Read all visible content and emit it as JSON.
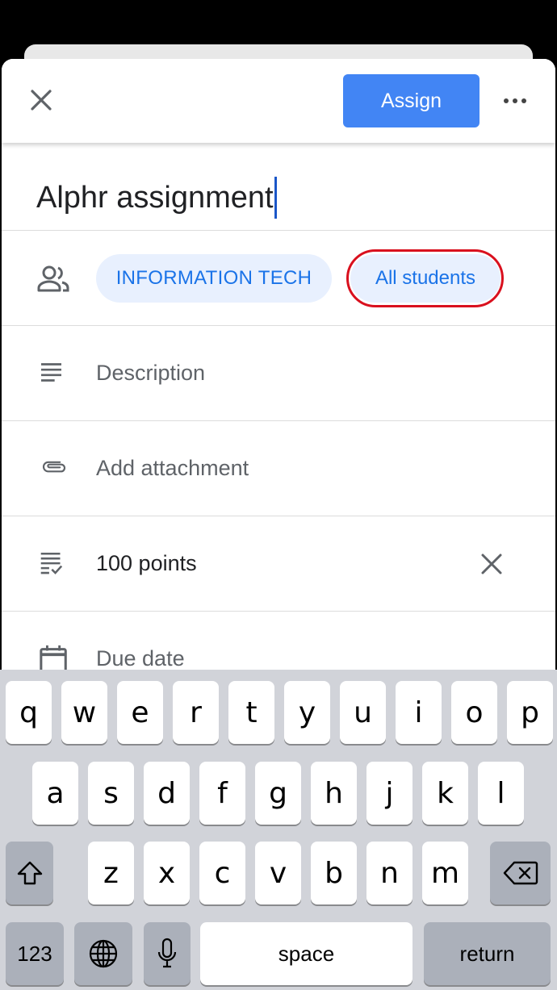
{
  "header": {
    "assign_label": "Assign"
  },
  "title": {
    "value": "Alphr assignment"
  },
  "audience": {
    "class_chip": "INFORMATION TECH",
    "students_chip": "All students"
  },
  "fields": {
    "description_placeholder": "Description",
    "attachment_label": "Add attachment",
    "points_value": "100 points",
    "due_date_label": "Due date"
  },
  "keyboard": {
    "row1": [
      "q",
      "w",
      "e",
      "r",
      "t",
      "y",
      "u",
      "i",
      "o",
      "p"
    ],
    "row2": [
      "a",
      "s",
      "d",
      "f",
      "g",
      "h",
      "j",
      "k",
      "l"
    ],
    "row3": [
      "z",
      "x",
      "c",
      "v",
      "b",
      "n",
      "m"
    ],
    "numbers_label": "123",
    "space_label": "space",
    "return_label": "return"
  },
  "colors": {
    "accent": "#4285f4",
    "chip_bg": "#e8f0fe",
    "chip_text": "#1a73e8",
    "highlight_ring": "#d9101e"
  }
}
